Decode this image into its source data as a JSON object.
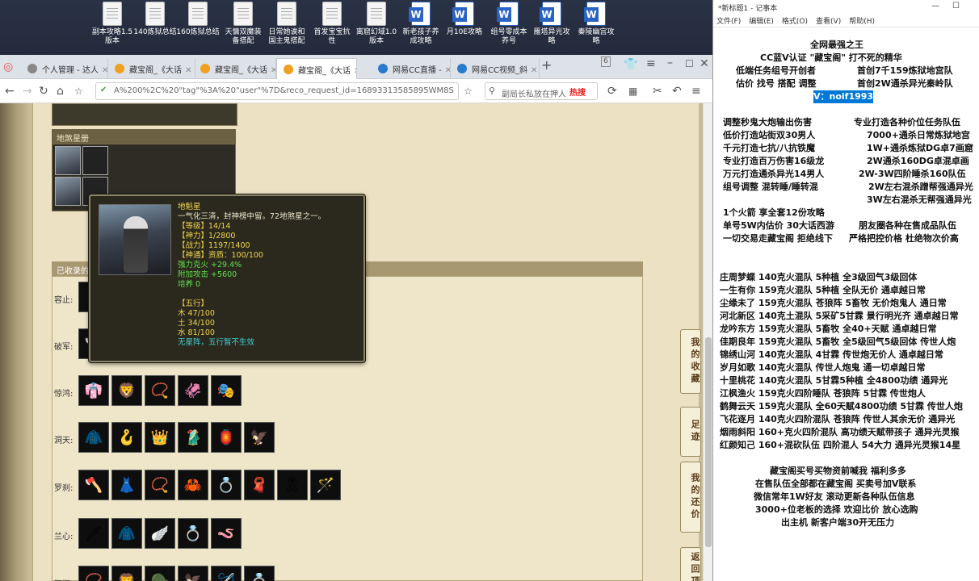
{
  "desktop": {
    "icons": [
      {
        "label": "副本攻略1.5\n版本",
        "type": "doc"
      },
      {
        "label": "140炼狱总结",
        "type": "doc"
      },
      {
        "label": "160炼狱总结",
        "type": "doc"
      },
      {
        "label": "天慵双魔装\n备搭配",
        "type": "doc"
      },
      {
        "label": "日常她诶和\n国主鬼搭配",
        "type": "doc"
      },
      {
        "label": "首发宝宝抗\n性",
        "type": "doc"
      },
      {
        "label": "离窟幻域1.0\n版本",
        "type": "doc"
      },
      {
        "label": "新老孩子养\n成攻略",
        "type": "word"
      },
      {
        "label": "月10E攻略",
        "type": "word"
      },
      {
        "label": "组号零成本\n养号",
        "type": "word"
      },
      {
        "label": "雁塔异光攻\n略",
        "type": "word"
      },
      {
        "label": "秦陵幽宫攻\n略",
        "type": "word"
      }
    ]
  },
  "browser": {
    "tabs": [
      {
        "label": "个人管理 - 达人",
        "active": false
      },
      {
        "label": "藏宝阁_《大话",
        "active": false
      },
      {
        "label": "藏宝阁_《大话",
        "active": false
      },
      {
        "label": "藏宝阁_《大话",
        "active": true
      },
      {
        "label": "网易CC直播 -",
        "active": false
      },
      {
        "label": "网易CC视频_斜",
        "active": false
      }
    ],
    "tab_count": "6",
    "address": "A%200%2C%20\"tag\"%3A%20\"user\"%7D&reco_request_id=16893313585895WM8S",
    "search_placeholder": "副局长私放在押人",
    "hot_label": "热搜"
  },
  "game": {
    "ds_header": "地煞星册",
    "collection_header": "已收录的",
    "rows": [
      {
        "label": "容止:",
        "icons": [
          "⚔"
        ]
      },
      {
        "label": "破军:",
        "icons": [
          "🪓",
          "🧥",
          "💍",
          "👟"
        ]
      },
      {
        "label": "惊鸿:",
        "icons": [
          "👘",
          "🦁",
          "📿",
          "🦑",
          "🎭"
        ]
      },
      {
        "label": "洞天:",
        "icons": [
          "🧥",
          "🪝",
          "👑",
          "🥻",
          "🏮",
          "🦅"
        ]
      },
      {
        "label": "罗刹:",
        "icons": [
          "🪓",
          "👗",
          "📿",
          "🦀",
          "💍",
          "🧣",
          "🎗",
          "🪄"
        ]
      },
      {
        "label": "兰心:",
        "icons": [
          "🗡",
          "🧥",
          "🪽",
          "💍",
          "🪱"
        ]
      },
      {
        "label": "狂翔:",
        "icons": [
          "📿",
          "🦁",
          "🪖",
          "🦅",
          "🪡",
          "💍"
        ]
      }
    ],
    "side_buttons": [
      "我的收藏",
      "足迹",
      "我的还价",
      "返回顶部"
    ]
  },
  "tooltip": {
    "name": "地魁星",
    "desc": "一气化三清，封神榜中留。72地煞星之一。",
    "level": "【等级】14/14",
    "shenli": "【神力】1/2800",
    "zhanli": "【战力】1197/1400",
    "shentong": "【神通】资质：100/100",
    "kehuo": "强力克火 +29.4%",
    "attack": "附加攻击 +5600",
    "peiyang": "培养 0",
    "wuxing_title": "【五行】",
    "mu": "木 47/100",
    "tu": "土 34/100",
    "shui": "水 81/100",
    "note": "无星阵，五行暂不生效"
  },
  "notepad": {
    "title": "*新标题1 - 记事本",
    "menu": [
      "文件(F)",
      "编辑(E)",
      "格式(O)",
      "查看(V)",
      "帮助(H)"
    ],
    "header_lines": [
      "全网最强之王",
      "CC蓝V认证 \"藏宝阁\" 打不死的精华",
      "低端任务组号开创者",
      "首创7千159炼狱地宫队",
      "估价 找号 搭配 调整",
      "首创2W通杀异光秦岭队",
      "V：noif1993"
    ],
    "services_left": [
      "调整秒鬼大炮输出伤害",
      "低价打造站街双30男人",
      "千元打造七抗/八抗铁魔",
      "专业打造百万伤害16级龙",
      "万元打造通杀异光14男人",
      "组号调整 混转睡/睡转混"
    ],
    "services_right": [
      "专业打造各种价位任务队伍",
      "7000+通杀日常炼狱地宫",
      "1W+通杀炼狱DG卓7画窟",
      "2W通杀160DG卓混卓画",
      "2W-3W四阶睡杀160队伍",
      "2W左右混杀蹭帮强通异光",
      "3W左右混杀无帮强通异光"
    ],
    "mid_lines": [
      "1个火箭 享全套12份攻略",
      "单号5W内估价 30大话西游",
      "朋友圈各种在售成品队伍",
      "一切交易走藏宝阁 拒绝线下",
      "严格把控价格 杜绝物次价高"
    ],
    "teams": [
      "庄周梦蝶 140克火混队 5种植 全3级回气3级回体",
      "一生有你 159克火混队 5种植 全队无价 通卓越日常",
      "尘缘未了 159克火混队 苍狼阵 5畜牧 无价炮鬼人 通日常",
      "河北新区 140克土混队 5采矿5甘霖 景行明光齐 通卓越日常",
      "龙吟东方 159克火混队 5畜牧 全40+天赋 通卓越日常",
      "佳期良年 159克火混队 5畜牧 全5级回气5级回体 传世人炮",
      "锦绣山河 140克火混队 4甘霖 传世炮无价人 通卓越日常",
      "岁月如歌 140克火混队 传世人炮鬼 通一切卓越日常",
      "十里桃花 140克火混队 5甘霖5种植 全4800功绩 通异光",
      "江枫渔火 159克火四阶睡队 苍狼阵 5甘霖 传世炮人",
      "鹤舞云天 159克火混队 全60天赋4800功绩 5甘霖 传世人炮",
      "飞花逐月 140克火四阶混队 苍狼阵 传世人其余无价 通异光",
      "烟雨斜阳 160+克火四阶混队 高功绩天赋带孩子 通异光灵猴",
      "红颜知己 160+混砍队伍 四阶混人 54大力 通异光灵猴14星"
    ],
    "footer": [
      "藏宝阁买号买物资前喊我 福利多多",
      "在售队伍全部都在藏宝阁 买卖号加V联系",
      "微信常年1W好友 滚动更新各种队伍信息",
      "3000+位老板的选择 欢迎比价 放心选购",
      "出主机 新客户端30开无压力"
    ]
  }
}
